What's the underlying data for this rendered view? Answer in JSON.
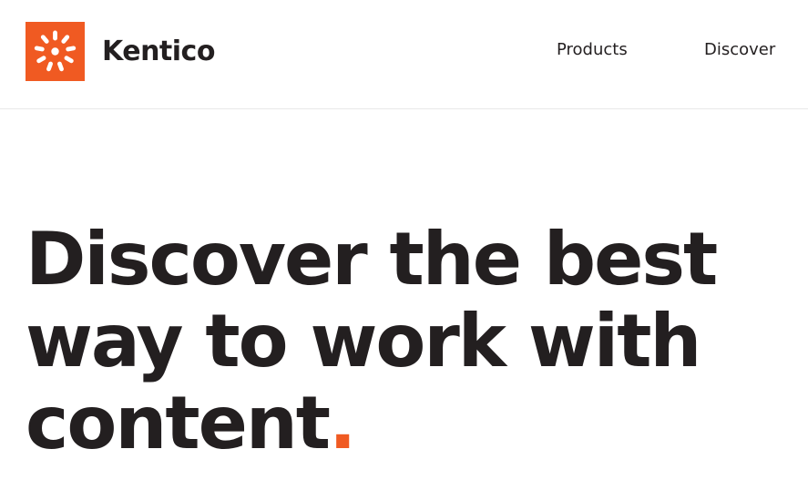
{
  "brand": {
    "name": "Kentico",
    "accent_color": "#f05a22",
    "logo_icon": "kentico-sunburst-icon"
  },
  "nav": {
    "items": [
      {
        "label": "Products"
      },
      {
        "label": "Discover"
      }
    ]
  },
  "hero": {
    "title_line1": "Discover the best",
    "title_line2": "way to work with",
    "title_line3": "content",
    "title_punctuation": "."
  }
}
